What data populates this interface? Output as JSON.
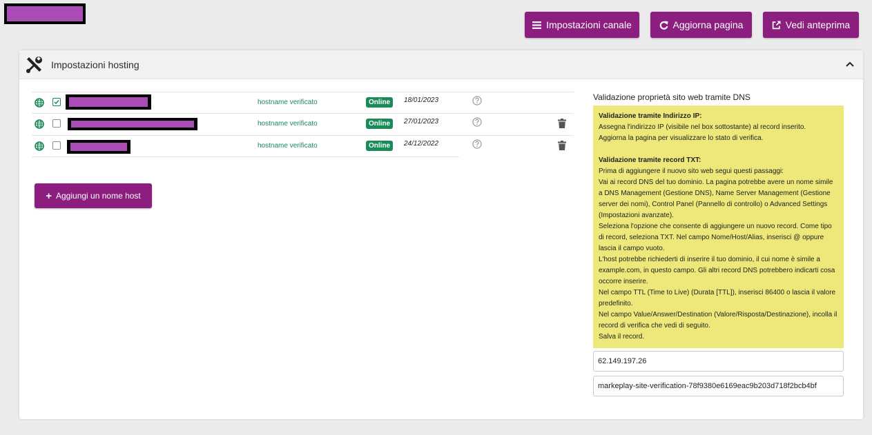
{
  "topbar": {
    "buttons": [
      {
        "label": "Impostazioni canale",
        "icon": "bars-icon"
      },
      {
        "label": "Aggiorna pagina",
        "icon": "refresh-icon"
      },
      {
        "label": "Vedi anteprima",
        "icon": "external-link-icon"
      }
    ]
  },
  "card": {
    "title": "Impostazioni hosting",
    "icon": "tools-icon",
    "collapse_icon": "chevron-up-icon"
  },
  "hosts": [
    {
      "status": "hostname verificato",
      "badge": "Online",
      "date": "18/01/2023",
      "checked": true,
      "deletable": false
    },
    {
      "status": "hostname verificato",
      "badge": "Online",
      "date": "27/01/2023",
      "checked": false,
      "deletable": true
    },
    {
      "status": "hostname verificato",
      "badge": "Online",
      "date": "24/12/2022",
      "checked": false,
      "deletable": true
    }
  ],
  "add_button": {
    "label": "Aggiungi un nome host",
    "icon": "plus-icon"
  },
  "dns": {
    "title": "Validazione proprietà sito web tramite DNS",
    "ip_heading": "Validazione tramite Indirizzo IP:",
    "ip_lines": [
      "Assegna l'indirizzo IP (visibile nel box sottostante) al record inserito.",
      "Aggiorna la pagina per visualizzare lo stato di verifica."
    ],
    "txt_heading": "Validazione tramite record TXT:",
    "txt_lines": [
      "Prima di aggiungere il nuovo sito web segui questi passaggi:",
      "Vai ai record DNS del tuo dominio. La pagina potrebbe avere un nome simile a DNS Management (Gestione DNS), Name Server Management (Gestione server dei nomi), Control Panel (Pannello di controllo) o Advanced Settings (Impostazioni avanzate).",
      "Seleziona l'opzione che consente di aggiungere un nuovo record. Come tipo di record, seleziona TXT. Nel campo Nome/Host/Alias, inserisci @ oppure lascia il campo vuoto.",
      "L'host potrebbe richiederti di inserire il tuo dominio, il cui nome è simile a example.com, in questo campo. Gli altri record DNS potrebbero indicarti cosa occorre inserire.",
      "Nel campo TTL (Time to Live) (Durata [TTL]), inserisci 86400 o lascia il valore predefinito.",
      "Nel campo Value/Answer/Destination (Valore/Risposta/Destinazione), incolla il record di verifica che vedi di seguito.",
      "Salva il record."
    ],
    "ip_value": "62.149.197.26",
    "txt_value": "markeplay-site-verification-78f9380e6169eac9b203d718f2bcb4bf"
  },
  "colors": {
    "accent": "#8b1e7e",
    "online": "#1a8a59",
    "note_bg": "#eee77a"
  }
}
